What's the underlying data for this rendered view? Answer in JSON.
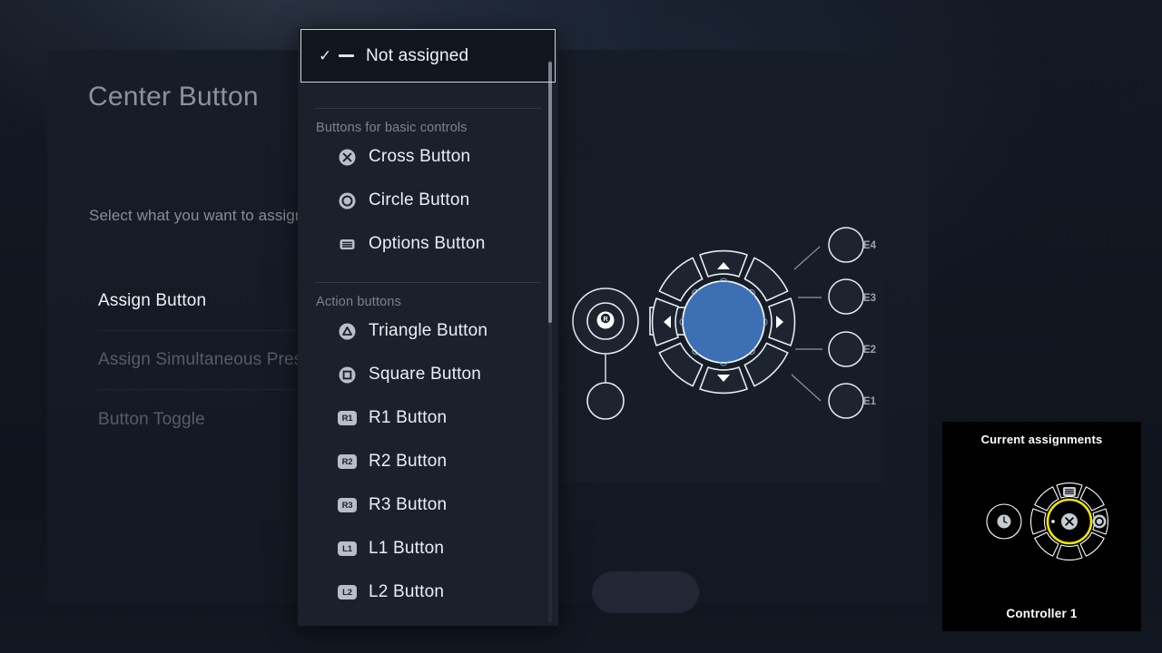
{
  "page": {
    "title": "Center Button",
    "description": "Select what you want to assign to the button."
  },
  "menu": {
    "items": [
      {
        "label": "Assign Button",
        "state": "active"
      },
      {
        "label": "Assign Simultaneous Press",
        "state": "normal"
      },
      {
        "label": "Button Toggle",
        "state": "normal"
      }
    ]
  },
  "dropdown": {
    "selected": {
      "label": "Not assigned",
      "check_icon": "check-icon",
      "dash_icon": "dash-icon"
    },
    "groups": [
      {
        "title": "Buttons for basic controls",
        "options": [
          {
            "label": "Cross Button",
            "icon": "cross-button-icon",
            "type": "glyph"
          },
          {
            "label": "Circle Button",
            "icon": "circle-button-icon",
            "type": "glyph"
          },
          {
            "label": "Options Button",
            "icon": "options-button-icon",
            "type": "glyph"
          }
        ]
      },
      {
        "title": "Action buttons",
        "options": [
          {
            "label": "Triangle Button",
            "icon": "triangle-button-icon",
            "type": "glyph"
          },
          {
            "label": "Square Button",
            "icon": "square-button-icon",
            "type": "glyph"
          },
          {
            "label": "R1 Button",
            "icon": "r1-badge-icon",
            "type": "badge",
            "badge": "R1"
          },
          {
            "label": "R2 Button",
            "icon": "r2-badge-icon",
            "type": "badge",
            "badge": "R2"
          },
          {
            "label": "R3 Button",
            "icon": "r3-badge-icon",
            "type": "badge",
            "badge": "R3"
          },
          {
            "label": "L1 Button",
            "icon": "l1-badge-icon",
            "type": "badge",
            "badge": "L1"
          },
          {
            "label": "L2 Button",
            "icon": "l2-badge-icon",
            "type": "badge",
            "badge": "L2"
          }
        ]
      }
    ]
  },
  "diagram": {
    "expansion_labels": [
      "E4",
      "E3",
      "E2",
      "E1"
    ],
    "center_highlight_color": "#3c6fb4",
    "stick_icon": "stick-r-icon",
    "dpad_icons": [
      "arrow-up-icon",
      "arrow-right-icon",
      "arrow-down-icon",
      "arrow-left-icon"
    ],
    "segment_numbers": [
      "1",
      "2",
      "3",
      "4",
      "5",
      "6",
      "7",
      "8"
    ]
  },
  "current_assignments": {
    "title": "Current assignments",
    "footer": "Controller 1",
    "highlight_color": "#f2e400",
    "center_icon": "cross-button-icon",
    "top_icon": "options-button-icon",
    "right_icon": "circle-button-icon",
    "left_icon": "profile-switch-icon"
  }
}
